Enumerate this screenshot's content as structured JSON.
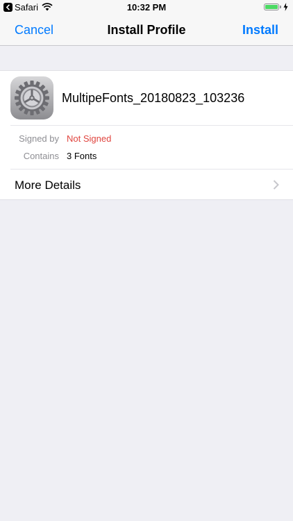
{
  "status_bar": {
    "back_app": "Safari",
    "time": "10:32 PM",
    "battery_level": 1.0
  },
  "nav": {
    "cancel_label": "Cancel",
    "title": "Install Profile",
    "install_label": "Install"
  },
  "profile": {
    "name": "MultipeFonts_20180823_103236",
    "icon": "settings-gear-icon",
    "signed_by_label": "Signed by",
    "signed_by_value": "Not Signed",
    "contains_label": "Contains",
    "contains_value": "3 Fonts",
    "more_details_label": "More Details"
  },
  "colors": {
    "accent": "#007aff",
    "not_signed": "#e0443e",
    "battery": "#4cd964",
    "background": "#efeff4"
  }
}
